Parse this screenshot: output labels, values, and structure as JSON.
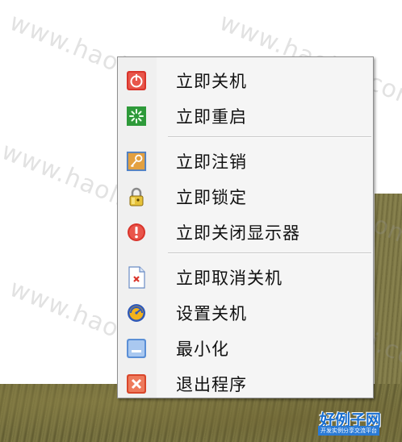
{
  "watermark": {
    "text": "www.haolizi.com"
  },
  "menu": {
    "items": [
      {
        "label": "立即关机",
        "icon": "power-icon"
      },
      {
        "label": "立即重启",
        "icon": "restart-icon"
      },
      {
        "label": "立即注销",
        "icon": "key-icon"
      },
      {
        "label": "立即锁定",
        "icon": "lock-icon"
      },
      {
        "label": "立即关闭显示器",
        "icon": "monitor-off-icon"
      },
      {
        "label": "立即取消关机",
        "icon": "cancel-shutdown-icon"
      },
      {
        "label": "设置关机",
        "icon": "settings-shutdown-icon"
      },
      {
        "label": "最小化",
        "icon": "minimize-icon"
      },
      {
        "label": "退出程序",
        "icon": "exit-icon"
      }
    ]
  },
  "logo": {
    "name": "好例子网",
    "tagline": "开发实例分享交流平台"
  },
  "colors": {
    "power": "#d9342b",
    "restart": "#2e9a3a",
    "key": "#e3a040",
    "warning": "#d9342b",
    "minimize": "#5b8fd6",
    "exit": "#d9462b"
  }
}
